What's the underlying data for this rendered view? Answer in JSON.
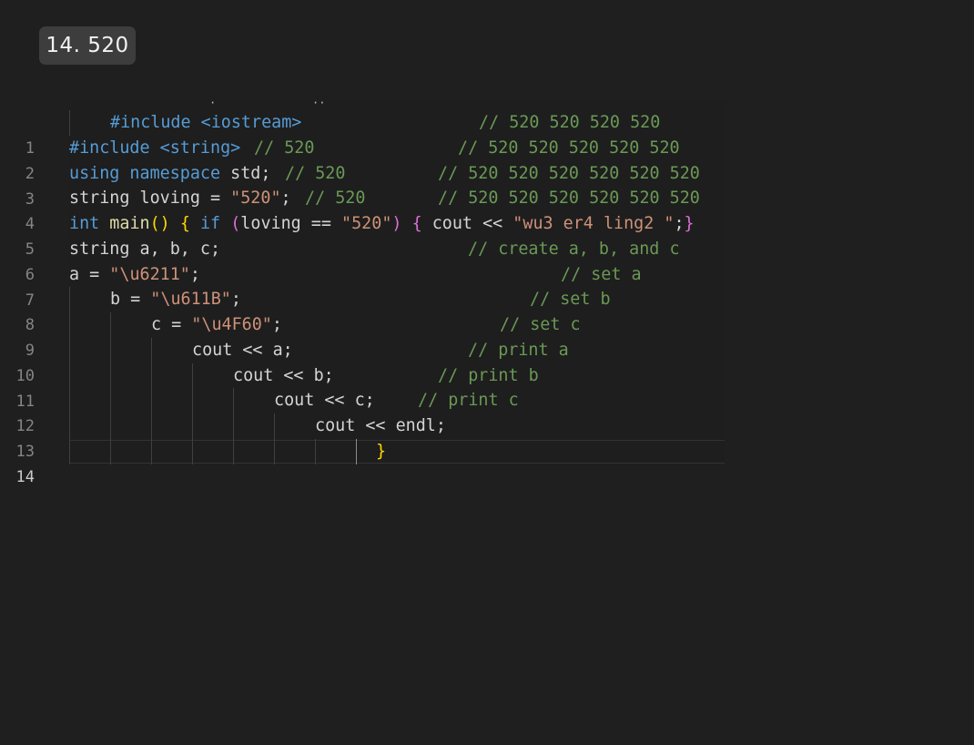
{
  "badge": {
    "label": "14. 520"
  },
  "editor": {
    "line_numbers": [
      "1",
      "2",
      "3",
      "4",
      "5",
      "6",
      "7",
      "8",
      "9",
      "10",
      "11",
      "12",
      "13",
      "14"
    ],
    "active_line": "14",
    "lines": {
      "l1": {
        "code": "#include <iostream>",
        "comment": "// 520 520 520 520"
      },
      "l2": {
        "code": "#include <string>",
        "inline_comment": "// 520",
        "comment": "// 520 520 520 520 520"
      },
      "l3": {
        "kw": "using namespace",
        "code": " std;",
        "inline_comment": "// 520",
        "comment": "// 520 520 520 520 520 520"
      },
      "l4": {
        "code": "string loving = ",
        "str": "\"520\"",
        "semi": ";",
        "inline_comment": "// 520",
        "comment": "// 520 520 520 520 520 520"
      },
      "l5": {
        "type": "int",
        "func": "main",
        "ifkw": "if",
        "var": "loving",
        "op": " == ",
        "str1": "\"520\"",
        "cout": "cout << ",
        "str2": "\"wu3 er4 ling2 \"",
        "end": ";"
      },
      "l6": {
        "code": "string a, b, c;",
        "comment": "// create a, b, and c"
      },
      "l7": {
        "code": "a = ",
        "str": "\"\\u6211\"",
        "semi": ";",
        "comment": "// set a"
      },
      "l8": {
        "code": "b = ",
        "str": "\"\\u611B\"",
        "semi": ";",
        "comment": "// set b"
      },
      "l9": {
        "code": "c = ",
        "str": "\"\\u4F60\"",
        "semi": ";",
        "comment": "// set c"
      },
      "l10": {
        "code": "cout << a;",
        "comment": "// print a"
      },
      "l11": {
        "code": "cout << b;",
        "comment": "// print b"
      },
      "l12": {
        "code": "cout << c;",
        "comment": "// print c"
      },
      "l13": {
        "code": "cout << endl;"
      },
      "l14": {
        "code": "}"
      }
    }
  },
  "colors": {
    "background": "#1f1f1f",
    "keyword": "#569cd6",
    "string": "#ce9178",
    "comment": "#6a9955",
    "text": "#d4d4d4",
    "bracket_gold": "#ffd700"
  }
}
